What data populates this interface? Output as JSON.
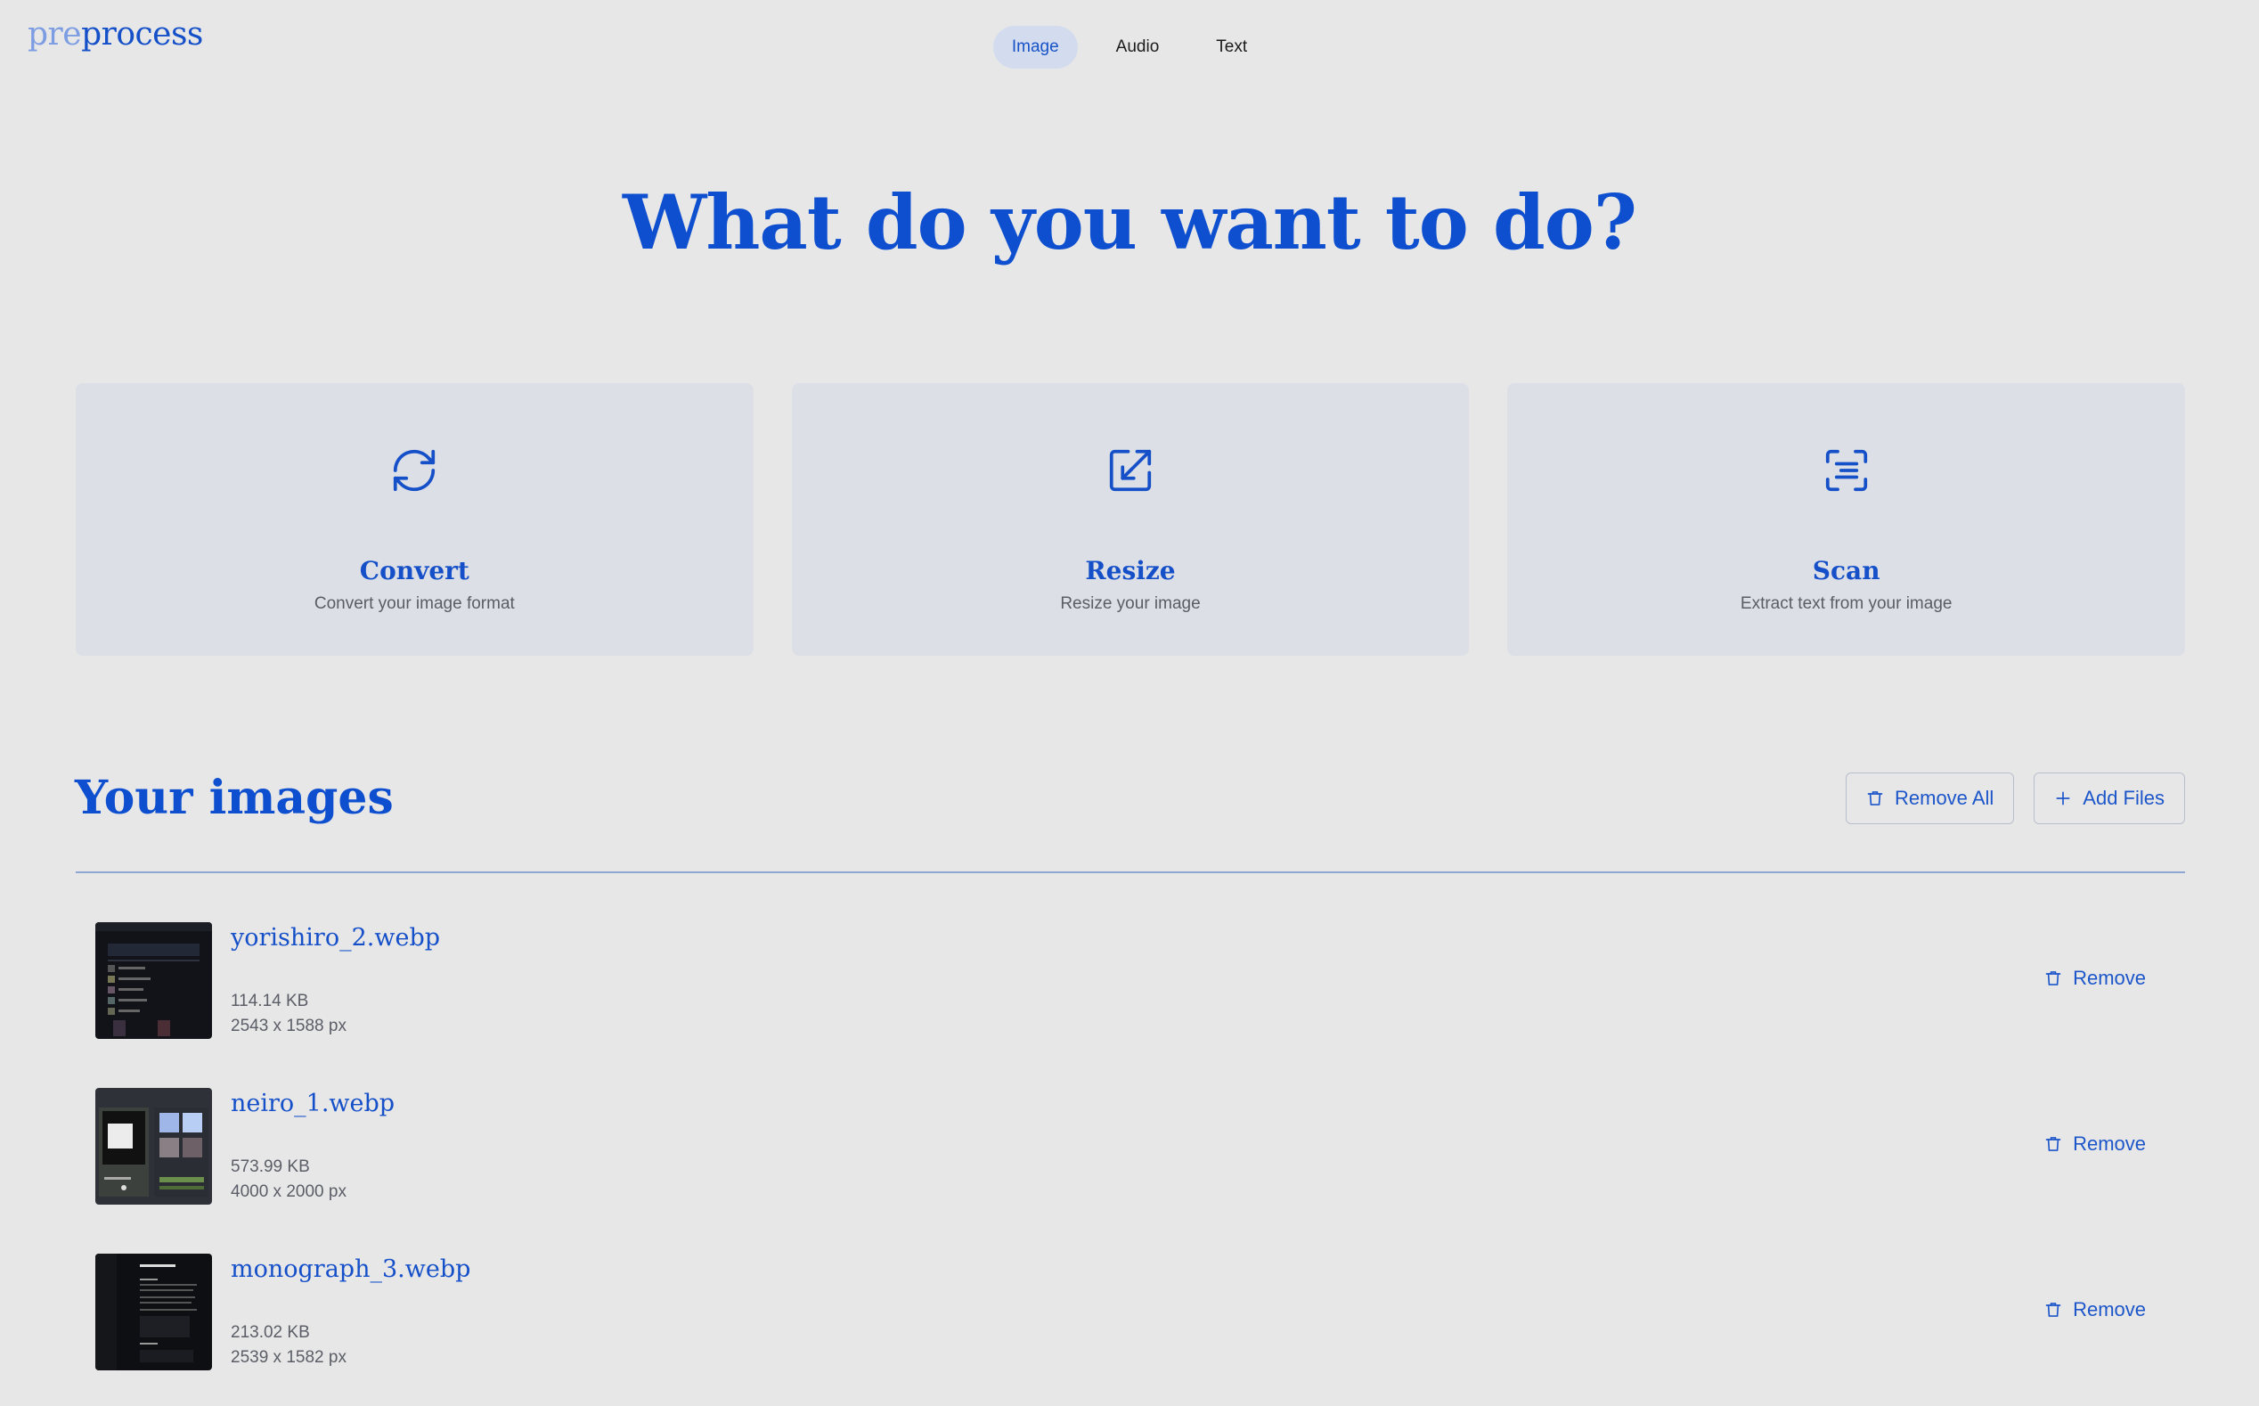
{
  "logo": {
    "pre": "pre",
    "rest": "process"
  },
  "tabs": [
    {
      "label": "Image",
      "active": true
    },
    {
      "label": "Audio",
      "active": false
    },
    {
      "label": "Text",
      "active": false
    }
  ],
  "hero": {
    "title": "What do you want to do?"
  },
  "cards": [
    {
      "icon": "refresh-icon",
      "title": "Convert",
      "subtitle": "Convert your image format"
    },
    {
      "icon": "resize-icon",
      "title": "Resize",
      "subtitle": "Resize your image"
    },
    {
      "icon": "scan-icon",
      "title": "Scan",
      "subtitle": "Extract text from your image"
    }
  ],
  "images_section": {
    "title": "Your images",
    "remove_all_label": "Remove All",
    "add_files_label": "Add Files"
  },
  "images": [
    {
      "name": "yorishiro_2.webp",
      "size": "114.14 KB",
      "dimensions": "2543 x 1588 px",
      "remove_label": "Remove"
    },
    {
      "name": "neiro_1.webp",
      "size": "573.99 KB",
      "dimensions": "4000 x 2000 px",
      "remove_label": "Remove"
    },
    {
      "name": "monograph_3.webp",
      "size": "213.02 KB",
      "dimensions": "2539 x 1582 px",
      "remove_label": "Remove"
    }
  ],
  "colors": {
    "accent": "#0e4fcf",
    "background": "#e7e7e8",
    "card": "#dcdfe6",
    "active_tab": "#d3dbee"
  }
}
